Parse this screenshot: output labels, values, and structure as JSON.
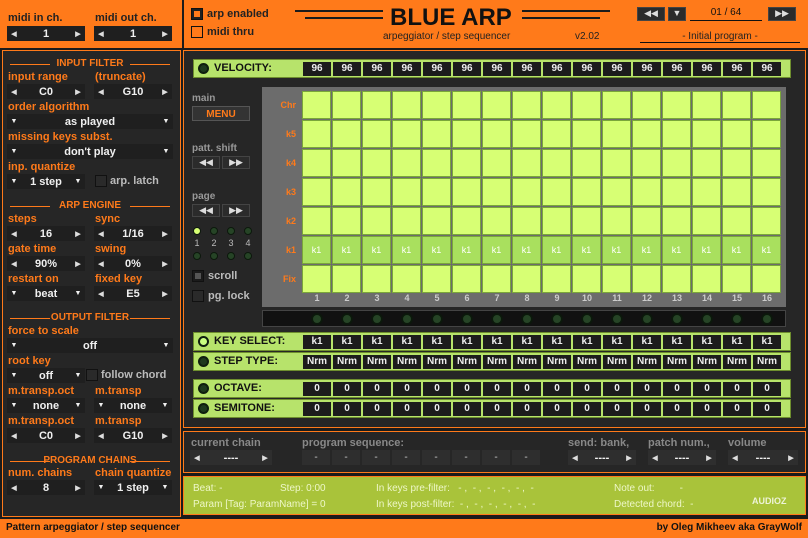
{
  "top": {
    "midi_in_label": "midi in ch.",
    "midi_in_value": "1",
    "midi_out_label": "midi out ch.",
    "midi_out_value": "1",
    "arp_enabled": "arp enabled",
    "midi_thru": "midi thru",
    "title": "BLUE ARP",
    "subtitle": "arpeggiator / step sequencer",
    "version": "v2.02",
    "program_counter": "01 / 64",
    "program_name": "- Initial program -"
  },
  "colors": {
    "orange": "#ff7a1a",
    "green": "#b7e36b",
    "cell": "#d7ff74"
  },
  "input_filter": {
    "header": "INPUT FILTER",
    "input_range": "input range",
    "truncate": "(truncate)",
    "range_low": "C0",
    "range_high": "G10",
    "order_algorithm": "order algorithm",
    "order_value": "as played",
    "missing_keys": "missing keys subst.",
    "missing_value": "don't play",
    "inp_quantize": "inp. quantize",
    "quantize_value": "1 step",
    "arp_latch": "arp. latch"
  },
  "arp_engine": {
    "header": "ARP ENGINE",
    "steps_label": "steps",
    "steps_value": "16",
    "sync_label": "sync",
    "sync_value": "1/16",
    "gate_label": "gate time",
    "gate_value": "90%",
    "swing_label": "swing",
    "swing_value": "0%",
    "restart_label": "restart on",
    "restart_value": "beat",
    "fixed_label": "fixed key",
    "fixed_value": "E5"
  },
  "output_filter": {
    "header": "OUTPUT FILTER",
    "force_label": "force to scale",
    "force_value": "off",
    "root_label": "root key",
    "root_value": "off",
    "follow_chord": "follow chord",
    "mtrans_oct_label": "m.transp.oct",
    "mtrans_oct_value": "none",
    "mtrans_label": "m.transp",
    "mtrans_value": "none",
    "mtrans_oct2_label": "m.transp.oct",
    "mtrans_oct2_value": "C0",
    "mtrans2_label": "m.transp",
    "mtrans2_value": "G10"
  },
  "program_chains": {
    "header": "PROGRAM CHAINS",
    "num_label": "num. chains",
    "num_value": "8",
    "chain_q_label": "chain quantize",
    "chain_q_value": "1 step"
  },
  "seq": {
    "main_label": "main",
    "menu": "MENU",
    "patt_shift": "patt. shift",
    "page": "page",
    "page_nums": [
      "1",
      "2",
      "3",
      "4"
    ],
    "scroll": "scroll",
    "pg_lock": "pg. lock"
  },
  "velocity": {
    "label": "VELOCITY:",
    "values": [
      "96",
      "96",
      "96",
      "96",
      "96",
      "96",
      "96",
      "96",
      "96",
      "96",
      "96",
      "96",
      "96",
      "96",
      "96",
      "96"
    ]
  },
  "grid": {
    "rows": [
      "Chr",
      "k5",
      "k4",
      "k3",
      "k2",
      "k1",
      "Fix"
    ],
    "active_row": "k1",
    "cell_text": "k1",
    "cols": [
      "1",
      "2",
      "3",
      "4",
      "5",
      "6",
      "7",
      "8",
      "9",
      "10",
      "11",
      "12",
      "13",
      "14",
      "15",
      "16"
    ]
  },
  "key_select": {
    "label": "KEY SELECT:",
    "values": [
      "k1",
      "k1",
      "k1",
      "k1",
      "k1",
      "k1",
      "k1",
      "k1",
      "k1",
      "k1",
      "k1",
      "k1",
      "k1",
      "k1",
      "k1",
      "k1"
    ]
  },
  "step_type": {
    "label": "STEP TYPE:",
    "values": [
      "Nrm",
      "Nrm",
      "Nrm",
      "Nrm",
      "Nrm",
      "Nrm",
      "Nrm",
      "Nrm",
      "Nrm",
      "Nrm",
      "Nrm",
      "Nrm",
      "Nrm",
      "Nrm",
      "Nrm",
      "Nrm"
    ]
  },
  "octave": {
    "label": "OCTAVE:",
    "values": [
      "0",
      "0",
      "0",
      "0",
      "0",
      "0",
      "0",
      "0",
      "0",
      "0",
      "0",
      "0",
      "0",
      "0",
      "0",
      "0"
    ]
  },
  "semitone": {
    "label": "SEMITONE:",
    "values": [
      "0",
      "0",
      "0",
      "0",
      "0",
      "0",
      "0",
      "0",
      "0",
      "0",
      "0",
      "0",
      "0",
      "0",
      "0",
      "0"
    ]
  },
  "bottom": {
    "current_chain": "current chain",
    "current_chain_value": "----",
    "program_sequence": "program sequence:",
    "seq_values": [
      "-",
      "-",
      "-",
      "-",
      "-",
      "-",
      "-",
      "-"
    ],
    "send_bank": "send: bank,",
    "send_bank_value": "----",
    "patch_num": "patch num.,",
    "patch_value": "----",
    "volume": "volume",
    "volume_value": "----"
  },
  "status": {
    "beat": "Beat: -",
    "step": "Step:  0:00",
    "in_pre": "In keys pre-filter:   - ,  - ,  - ,  - ,  - ,  -",
    "note_out": "Note out:         -",
    "param": "Param [Tag: ParamName] = 0",
    "in_post": "In keys post-filter:  - ,  - ,  - ,  - ,  - ,  -",
    "detected": "Detected chord:  -",
    "watermark": "AUDIOZ"
  },
  "footer": {
    "left": "Pattern arpeggiator / step sequencer",
    "right": "by Oleg Mikheev aka GrayWolf"
  }
}
